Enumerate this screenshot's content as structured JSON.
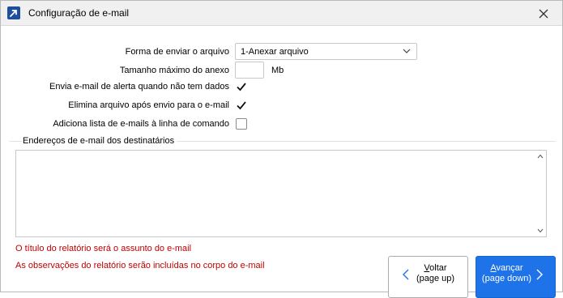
{
  "window": {
    "title": "Configuração de e-mail",
    "icon": "arrow-up-right-icon",
    "close_icon": "close-icon"
  },
  "form": {
    "send_mode_label": "Forma de enviar o arquivo",
    "send_mode_value": "1-Anexar arquivo",
    "max_size_label": "Tamanho máximo do anexo",
    "max_size_value": "",
    "max_size_unit": "Mb",
    "alert_label": "Envia e-mail de alerta quando não tem dados",
    "alert_checked": true,
    "delete_label": "Elimina arquivo após envio para o e-mail",
    "delete_checked": true,
    "cmdline_label": "Adiciona lista de e-mails à linha de comando",
    "cmdline_checked": false
  },
  "recipients": {
    "section_label": "Endereços de e-mail dos destinatários",
    "value": ""
  },
  "notices": [
    "O título do relatório será o assunto do e-mail",
    "As observações do relatório serão incluídas no corpo do e-mail"
  ],
  "buttons": {
    "back_underlined": "V",
    "back_rest": "oltar",
    "back_sub": "(page up)",
    "next_underlined": "A",
    "next_rest": "vançar",
    "next_sub": "(page down)"
  },
  "colors": {
    "accent": "#1e73e8",
    "notice": "#c00000",
    "app_icon": "#1f4e9c"
  }
}
